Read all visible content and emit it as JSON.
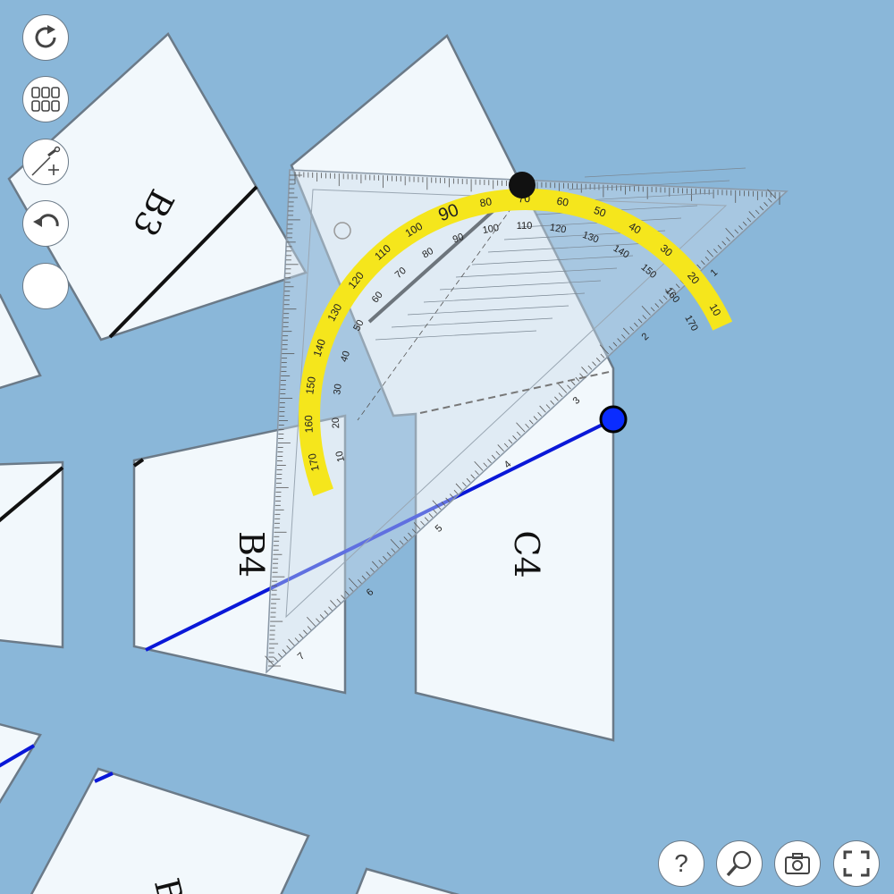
{
  "pieces": {
    "b3": "B3",
    "b4": "B4",
    "c4": "C4",
    "b5_partial": "B"
  },
  "protractor": {
    "outer_labels": [
      "10",
      "20",
      "30",
      "40",
      "50",
      "60",
      "70",
      "80",
      "90",
      "100",
      "110",
      "120",
      "130",
      "140",
      "150",
      "160",
      "170"
    ],
    "inner_labels": [
      "170",
      "160",
      "150",
      "140",
      "130",
      "120",
      "110",
      "100",
      "90",
      "80",
      "70",
      "60",
      "50",
      "40",
      "30",
      "20",
      "10"
    ]
  },
  "setsquare": {
    "scale_labels": [
      "1",
      "2",
      "3",
      "4",
      "5",
      "6",
      "7"
    ]
  },
  "toolbar": {
    "rotate_icon": "rotate-icon",
    "grid_icon": "grid-icon",
    "draw_line_icon": "pen-plus-icon",
    "undo_icon": "undo-icon",
    "blank_icon": "blank-icon"
  },
  "bottom_bar": {
    "help_label": "?",
    "help_icon": "help-icon",
    "zoom_icon": "zoom-icon",
    "camera_icon": "camera-icon",
    "fullscreen_icon": "fullscreen-icon"
  },
  "colors": {
    "background": "#8ab7d9",
    "piece_fill": "#f2f8fc",
    "piece_stroke": "#6b7a88",
    "blue_line": "#0a18d8",
    "yellow_band": "#f5e61c"
  }
}
